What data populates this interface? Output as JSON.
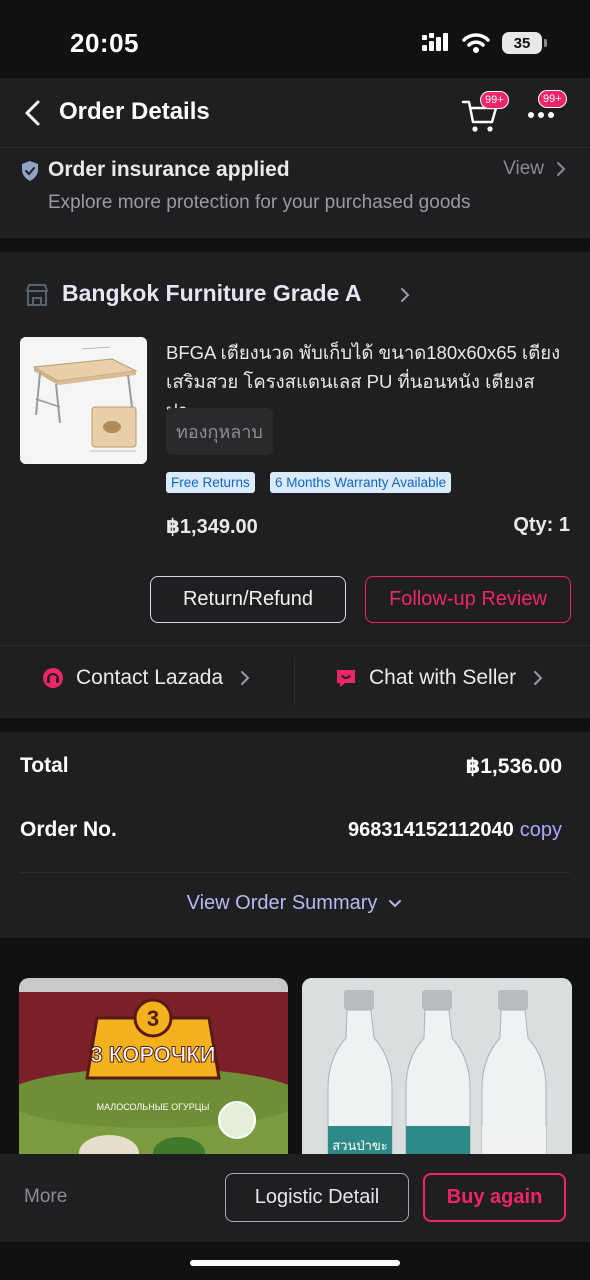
{
  "status_bar": {
    "time": "20:05",
    "battery": "35"
  },
  "header": {
    "title": "Order Details",
    "cart_badge": "99+",
    "more_badge": "99+"
  },
  "insurance": {
    "title": "Order insurance applied",
    "subtitle": "Explore more protection for your purchased goods",
    "view_label": "View"
  },
  "store": {
    "name": "Bangkok Furniture Grade A"
  },
  "product": {
    "title": "BFGA เตียงนวด พับเก็บได้ ขนาด180x60x65 เตียงเสริมสวย โครงสแตนเลส PU ที่นอนหนัง เตียงสปา...",
    "variant": "ทองกุหลาบ",
    "tags": [
      "Free Returns",
      "6 Months Warranty Available"
    ],
    "price": "฿1,349.00",
    "qty": "Qty: 1"
  },
  "actions": {
    "return_label": "Return/Refund",
    "review_label": "Follow-up Review"
  },
  "contact": {
    "lazada_label": "Contact Lazada",
    "seller_label": "Chat with Seller"
  },
  "totals": {
    "total_label": "Total",
    "total_value": "฿1,536.00",
    "order_label": "Order No.",
    "order_value": "968314152112040",
    "copy_label": "copy",
    "summary_label": "View Order Summary"
  },
  "recommendations": {
    "item1_brand": "3 КОРОЧКИ",
    "item1_sub": "МАЛОСОЛЬНЫЕ ОГУРЦЫ",
    "item2_label": "สวนป่าขะ"
  },
  "bottom_bar": {
    "more_label": "More",
    "logistic_label": "Logistic Detail",
    "buy_again_label": "Buy again"
  },
  "colors": {
    "accent": "#f0246b",
    "background": "#111113",
    "card": "#1f1f21",
    "link": "#b9b9f2",
    "tag_bg": "#d9ecff",
    "tag_text": "#1664c8"
  }
}
